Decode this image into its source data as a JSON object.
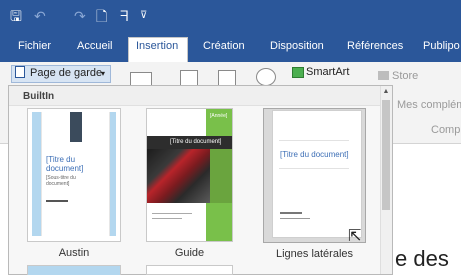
{
  "quick_access": {
    "icons": [
      "save-icon",
      "undo-icon",
      "redo-icon",
      "new-document-icon",
      "touch-mode-icon",
      "customize-icon"
    ],
    "save_glyph": "🖫",
    "undo_glyph": "↶",
    "redo_glyph": "↷",
    "new_glyph": "🗋",
    "touch_glyph": "ᖷ",
    "more_glyph": "⊽"
  },
  "tabs": [
    {
      "label": "Fichier"
    },
    {
      "label": "Accueil"
    },
    {
      "label": "Insertion",
      "active": true
    },
    {
      "label": "Création"
    },
    {
      "label": "Disposition"
    },
    {
      "label": "Références"
    },
    {
      "label": "Publipo"
    }
  ],
  "ribbon": {
    "cover_page_button": "Page de garde",
    "cover_page_arrow": "▾",
    "smartart": "SmartArt",
    "store": "Store",
    "my_addins": "Mes complém",
    "group_partial": "Compl"
  },
  "gallery": {
    "section": "BuiltIn",
    "items": [
      {
        "label": "Austin",
        "doc_title": "[Titre du document]",
        "doc_subtitle": "[Sous-titre du document]"
      },
      {
        "label": "Guide",
        "doc_title": "[Titre du document]",
        "header_text": "[Année]"
      },
      {
        "label": "Lignes latérales",
        "doc_title": "[Titre du document]",
        "selected": true
      }
    ]
  },
  "document": {
    "visible_text": "e des"
  },
  "colors": {
    "ribbon_blue": "#2b579a",
    "guide_green": "#79c04a",
    "austin_blue": "#b3d7ef"
  }
}
